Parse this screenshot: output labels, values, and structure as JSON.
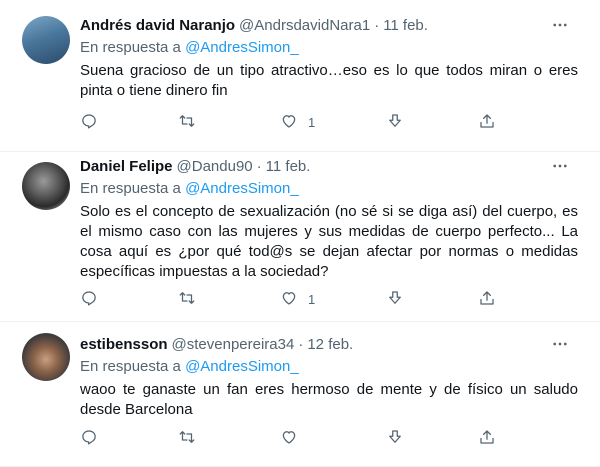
{
  "tweets": [
    {
      "name": "Andrés david Naranjo",
      "handle": "@AndrsdavidNara1",
      "dot": "·",
      "date": "11 feb.",
      "reply_prefix": "En respuesta a",
      "reply_mention": "@AndresSimon_",
      "text": "Suena gracioso de un tipo atractivo…eso es lo que todos miran o eres pinta o tiene dinero fin",
      "likes": "1"
    },
    {
      "name": "Daniel Felipe",
      "handle": "@Dandu90",
      "dot": "·",
      "date": "11 feb.",
      "reply_prefix": "En respuesta a",
      "reply_mention": "@AndresSimon_",
      "text": "Solo es el concepto de sexualización (no sé si se diga así) del cuerpo, es el mismo caso con las mujeres y sus medidas de cuerpo perfecto... La cosa aquí es ¿por qué tod@s se dejan afectar por normas o medidas específicas impuestas a la sociedad?",
      "likes": "1"
    },
    {
      "name": "estibensson",
      "handle": "@stevenpereira34",
      "dot": "·",
      "date": "12 feb.",
      "reply_prefix": "En respuesta a",
      "reply_mention": "@AndresSimon_",
      "text": "waoo te ganaste un fan eres hermoso de mente y de físico un saludo desde Barcelona",
      "likes": ""
    }
  ],
  "icons": {
    "more": "more-icon",
    "reply": "reply-icon",
    "retweet": "retweet-icon",
    "like": "heart-icon",
    "share": "share-icon",
    "upload": "upload-icon"
  },
  "colors": {
    "link": "#1d9bf0",
    "secondary_text": "#536471",
    "primary_text": "#0f1419",
    "divider": "#eff3f4"
  }
}
